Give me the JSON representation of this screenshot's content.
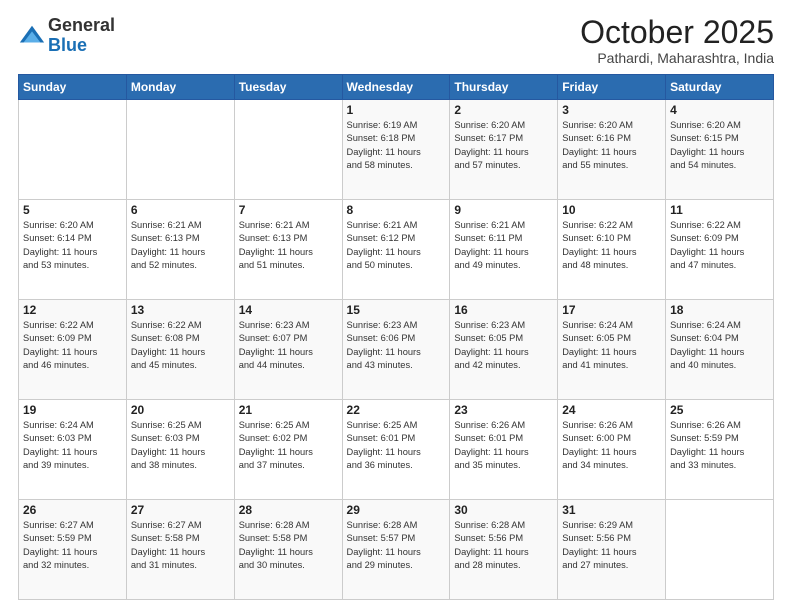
{
  "header": {
    "logo": {
      "line1": "General",
      "line2": "Blue"
    },
    "title": "October 2025",
    "subtitle": "Pathardi, Maharashtra, India"
  },
  "weekdays": [
    "Sunday",
    "Monday",
    "Tuesday",
    "Wednesday",
    "Thursday",
    "Friday",
    "Saturday"
  ],
  "weeks": [
    [
      {
        "day": "",
        "info": ""
      },
      {
        "day": "",
        "info": ""
      },
      {
        "day": "",
        "info": ""
      },
      {
        "day": "1",
        "info": "Sunrise: 6:19 AM\nSunset: 6:18 PM\nDaylight: 11 hours\nand 58 minutes."
      },
      {
        "day": "2",
        "info": "Sunrise: 6:20 AM\nSunset: 6:17 PM\nDaylight: 11 hours\nand 57 minutes."
      },
      {
        "day": "3",
        "info": "Sunrise: 6:20 AM\nSunset: 6:16 PM\nDaylight: 11 hours\nand 55 minutes."
      },
      {
        "day": "4",
        "info": "Sunrise: 6:20 AM\nSunset: 6:15 PM\nDaylight: 11 hours\nand 54 minutes."
      }
    ],
    [
      {
        "day": "5",
        "info": "Sunrise: 6:20 AM\nSunset: 6:14 PM\nDaylight: 11 hours\nand 53 minutes."
      },
      {
        "day": "6",
        "info": "Sunrise: 6:21 AM\nSunset: 6:13 PM\nDaylight: 11 hours\nand 52 minutes."
      },
      {
        "day": "7",
        "info": "Sunrise: 6:21 AM\nSunset: 6:13 PM\nDaylight: 11 hours\nand 51 minutes."
      },
      {
        "day": "8",
        "info": "Sunrise: 6:21 AM\nSunset: 6:12 PM\nDaylight: 11 hours\nand 50 minutes."
      },
      {
        "day": "9",
        "info": "Sunrise: 6:21 AM\nSunset: 6:11 PM\nDaylight: 11 hours\nand 49 minutes."
      },
      {
        "day": "10",
        "info": "Sunrise: 6:22 AM\nSunset: 6:10 PM\nDaylight: 11 hours\nand 48 minutes."
      },
      {
        "day": "11",
        "info": "Sunrise: 6:22 AM\nSunset: 6:09 PM\nDaylight: 11 hours\nand 47 minutes."
      }
    ],
    [
      {
        "day": "12",
        "info": "Sunrise: 6:22 AM\nSunset: 6:09 PM\nDaylight: 11 hours\nand 46 minutes."
      },
      {
        "day": "13",
        "info": "Sunrise: 6:22 AM\nSunset: 6:08 PM\nDaylight: 11 hours\nand 45 minutes."
      },
      {
        "day": "14",
        "info": "Sunrise: 6:23 AM\nSunset: 6:07 PM\nDaylight: 11 hours\nand 44 minutes."
      },
      {
        "day": "15",
        "info": "Sunrise: 6:23 AM\nSunset: 6:06 PM\nDaylight: 11 hours\nand 43 minutes."
      },
      {
        "day": "16",
        "info": "Sunrise: 6:23 AM\nSunset: 6:05 PM\nDaylight: 11 hours\nand 42 minutes."
      },
      {
        "day": "17",
        "info": "Sunrise: 6:24 AM\nSunset: 6:05 PM\nDaylight: 11 hours\nand 41 minutes."
      },
      {
        "day": "18",
        "info": "Sunrise: 6:24 AM\nSunset: 6:04 PM\nDaylight: 11 hours\nand 40 minutes."
      }
    ],
    [
      {
        "day": "19",
        "info": "Sunrise: 6:24 AM\nSunset: 6:03 PM\nDaylight: 11 hours\nand 39 minutes."
      },
      {
        "day": "20",
        "info": "Sunrise: 6:25 AM\nSunset: 6:03 PM\nDaylight: 11 hours\nand 38 minutes."
      },
      {
        "day": "21",
        "info": "Sunrise: 6:25 AM\nSunset: 6:02 PM\nDaylight: 11 hours\nand 37 minutes."
      },
      {
        "day": "22",
        "info": "Sunrise: 6:25 AM\nSunset: 6:01 PM\nDaylight: 11 hours\nand 36 minutes."
      },
      {
        "day": "23",
        "info": "Sunrise: 6:26 AM\nSunset: 6:01 PM\nDaylight: 11 hours\nand 35 minutes."
      },
      {
        "day": "24",
        "info": "Sunrise: 6:26 AM\nSunset: 6:00 PM\nDaylight: 11 hours\nand 34 minutes."
      },
      {
        "day": "25",
        "info": "Sunrise: 6:26 AM\nSunset: 5:59 PM\nDaylight: 11 hours\nand 33 minutes."
      }
    ],
    [
      {
        "day": "26",
        "info": "Sunrise: 6:27 AM\nSunset: 5:59 PM\nDaylight: 11 hours\nand 32 minutes."
      },
      {
        "day": "27",
        "info": "Sunrise: 6:27 AM\nSunset: 5:58 PM\nDaylight: 11 hours\nand 31 minutes."
      },
      {
        "day": "28",
        "info": "Sunrise: 6:28 AM\nSunset: 5:58 PM\nDaylight: 11 hours\nand 30 minutes."
      },
      {
        "day": "29",
        "info": "Sunrise: 6:28 AM\nSunset: 5:57 PM\nDaylight: 11 hours\nand 29 minutes."
      },
      {
        "day": "30",
        "info": "Sunrise: 6:28 AM\nSunset: 5:56 PM\nDaylight: 11 hours\nand 28 minutes."
      },
      {
        "day": "31",
        "info": "Sunrise: 6:29 AM\nSunset: 5:56 PM\nDaylight: 11 hours\nand 27 minutes."
      },
      {
        "day": "",
        "info": ""
      }
    ]
  ]
}
